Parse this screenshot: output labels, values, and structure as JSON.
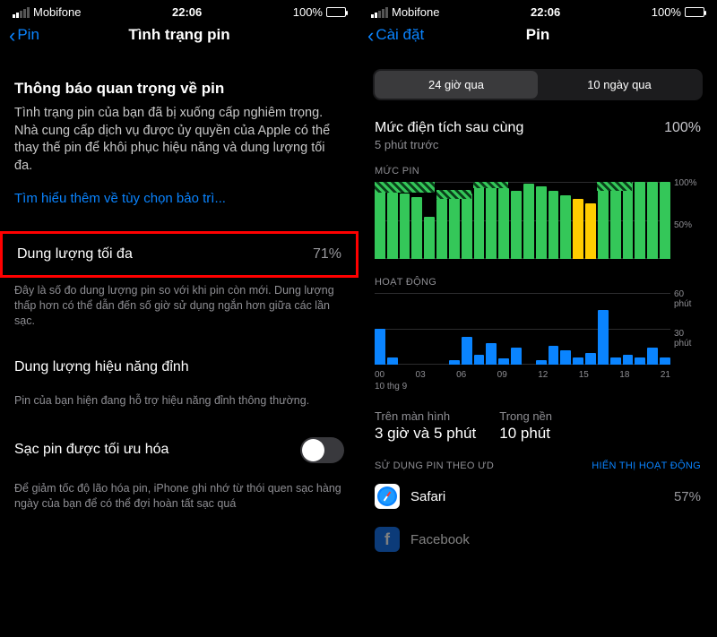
{
  "status": {
    "carrier": "Mobifone",
    "time": "22:06",
    "battery": "100%"
  },
  "left": {
    "back": "Pin",
    "title": "Tình trạng pin",
    "notice_h": "Thông báo quan trọng về pin",
    "notice_body": "Tình trạng pin của bạn đã bị xuống cấp nghiêm trọng. Nhà cung cấp dịch vụ được ủy quyền của Apple có thể thay thế pin để khôi phục hiệu năng và dung lượng tối đa.",
    "learn_more": "Tìm hiểu thêm về tùy chọn bảo trì...",
    "max_label": "Dung lượng tối đa",
    "max_value": "71%",
    "max_desc": "Đây là số đo dung lượng pin so với khi pin còn mới. Dung lượng thấp hơn có thể dẫn đến số giờ sử dụng ngắn hơn giữa các lần sạc.",
    "peak_label": "Dung lượng hiệu năng đỉnh",
    "peak_desc": "Pin của bạn hiện đang hỗ trợ hiệu năng đỉnh thông thường.",
    "opt_label": "Sạc pin được tối ưu hóa",
    "opt_desc": "Để giảm tốc độ lão hóa pin, iPhone ghi nhớ từ thói quen sạc hàng ngày của bạn để có thể đợi hoàn tất sạc quá"
  },
  "right": {
    "back": "Cài đặt",
    "title": "Pin",
    "seg_24": "24 giờ qua",
    "seg_10": "10 ngày qua",
    "last_charge": "Mức điện tích sau cùng",
    "last_sub": "5 phút trước",
    "last_val": "100%",
    "level_h": "MỨC PIN",
    "activity_h": "HOẠT ĐỘNG",
    "screen_on_l": "Trên màn hình",
    "screen_on_v": "3 giờ và 5 phút",
    "bg_l": "Trong nền",
    "bg_v": "10 phút",
    "usage_by_app": "SỬ DỤNG PIN THEO ƯD",
    "show_activity": "HIỂN THỊ HOẠT ĐỘNG",
    "safari": "Safari",
    "safari_pct": "57%",
    "facebook": "Facebook",
    "date_meta": "10 thg 9"
  },
  "chart_data": [
    {
      "type": "bar",
      "title": "MỨC PIN",
      "ylabel": "%",
      "ylim": [
        0,
        100
      ],
      "xticks": [
        "00",
        "03",
        "06",
        "09",
        "12",
        "15",
        "18",
        "21"
      ],
      "series": [
        {
          "name": "charging",
          "style": "hatch",
          "ranges": [
            [
              0,
              4,
              86,
              100
            ],
            [
              5,
              7,
              78,
              90
            ],
            [
              8,
              10,
              92,
              100
            ],
            [
              18,
              20,
              88,
              100
            ]
          ]
        }
      ],
      "bars": [
        {
          "v": 88,
          "c": "green"
        },
        {
          "v": 86,
          "c": "green"
        },
        {
          "v": 85,
          "c": "green"
        },
        {
          "v": 80,
          "c": "green"
        },
        {
          "v": 55,
          "c": "green"
        },
        {
          "v": 78,
          "c": "green"
        },
        {
          "v": 80,
          "c": "green"
        },
        {
          "v": 85,
          "c": "green"
        },
        {
          "v": 100,
          "c": "green"
        },
        {
          "v": 98,
          "c": "green"
        },
        {
          "v": 92,
          "c": "green"
        },
        {
          "v": 88,
          "c": "green"
        },
        {
          "v": 98,
          "c": "green"
        },
        {
          "v": 94,
          "c": "green"
        },
        {
          "v": 88,
          "c": "green"
        },
        {
          "v": 82,
          "c": "green"
        },
        {
          "v": 78,
          "c": "yellow"
        },
        {
          "v": 72,
          "c": "yellow"
        },
        {
          "v": 95,
          "c": "green"
        },
        {
          "v": 100,
          "c": "green"
        },
        {
          "v": 100,
          "c": "green"
        },
        {
          "v": 100,
          "c": "green"
        },
        {
          "v": 100,
          "c": "green"
        },
        {
          "v": 100,
          "c": "green"
        }
      ]
    },
    {
      "type": "bar",
      "title": "HOẠT ĐỘNG",
      "ylabel": "phút",
      "ylim": [
        0,
        60
      ],
      "xticks": [
        "00",
        "03",
        "06",
        "09",
        "12",
        "15",
        "18",
        "21"
      ],
      "bars": [
        {
          "v": 30,
          "c": "blue"
        },
        {
          "v": 6,
          "c": "blue"
        },
        {
          "v": 0,
          "c": "blue"
        },
        {
          "v": 0,
          "c": "blue"
        },
        {
          "v": 0,
          "c": "blue"
        },
        {
          "v": 0,
          "c": "blue"
        },
        {
          "v": 4,
          "c": "blue"
        },
        {
          "v": 23,
          "c": "blue"
        },
        {
          "v": 8,
          "c": "blue"
        },
        {
          "v": 18,
          "c": "blue"
        },
        {
          "v": 5,
          "c": "blue"
        },
        {
          "v": 14,
          "c": "blue"
        },
        {
          "v": 0,
          "c": "blue"
        },
        {
          "v": 4,
          "c": "blue"
        },
        {
          "v": 16,
          "c": "blue"
        },
        {
          "v": 12,
          "c": "blue"
        },
        {
          "v": 6,
          "c": "blue"
        },
        {
          "v": 10,
          "c": "blue"
        },
        {
          "v": 46,
          "c": "blue"
        },
        {
          "v": 6,
          "c": "blue"
        },
        {
          "v": 8,
          "c": "blue"
        },
        {
          "v": 6,
          "c": "blue"
        },
        {
          "v": 14,
          "c": "blue"
        },
        {
          "v": 6,
          "c": "blue"
        }
      ]
    }
  ]
}
